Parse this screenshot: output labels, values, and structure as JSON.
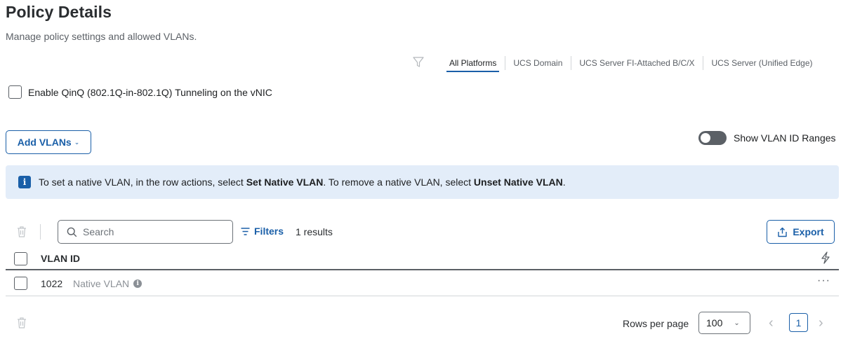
{
  "page": {
    "title": "Policy Details",
    "subtitle": "Manage policy settings and allowed VLANs."
  },
  "platform_tabs": [
    {
      "label": "All Platforms",
      "active": true
    },
    {
      "label": "UCS Domain",
      "active": false
    },
    {
      "label": "UCS Server FI-Attached B/C/X",
      "active": false
    },
    {
      "label": "UCS Server (Unified Edge)",
      "active": false
    }
  ],
  "qinq": {
    "label": "Enable QinQ (802.1Q-in-802.1Q) Tunneling on the vNIC",
    "checked": false
  },
  "add_vlans": {
    "label": "Add VLANs",
    "chevron": "⌄"
  },
  "vlan_ranges_toggle": {
    "label": "Show VLAN ID Ranges",
    "on": false
  },
  "info_banner": {
    "icon": "i",
    "text_1": "To set a native VLAN, in the row actions, select ",
    "bold_1": "Set Native VLAN",
    "text_2": ". To remove a native VLAN, select ",
    "bold_2": "Unset Native VLAN",
    "text_3": "."
  },
  "toolbar": {
    "search_placeholder": "Search",
    "filters_label": "Filters",
    "results_text": "1 results",
    "export_label": "Export"
  },
  "table": {
    "columns": [
      "VLAN ID"
    ],
    "rows": [
      {
        "vlan_id": "1022",
        "tag": "Native VLAN",
        "tag_icon": "i",
        "actions": "···"
      }
    ]
  },
  "pagination": {
    "rows_per_page_label": "Rows per page",
    "rows_per_page_value": "100",
    "rows_chevron": "⌄",
    "current_page": "1",
    "prev": "‹",
    "next": "›"
  },
  "colors": {
    "accent": "#1a5fa8",
    "banner_bg": "#e3edf9",
    "text_primary": "#1d1f21",
    "text_muted": "#8b9096"
  }
}
